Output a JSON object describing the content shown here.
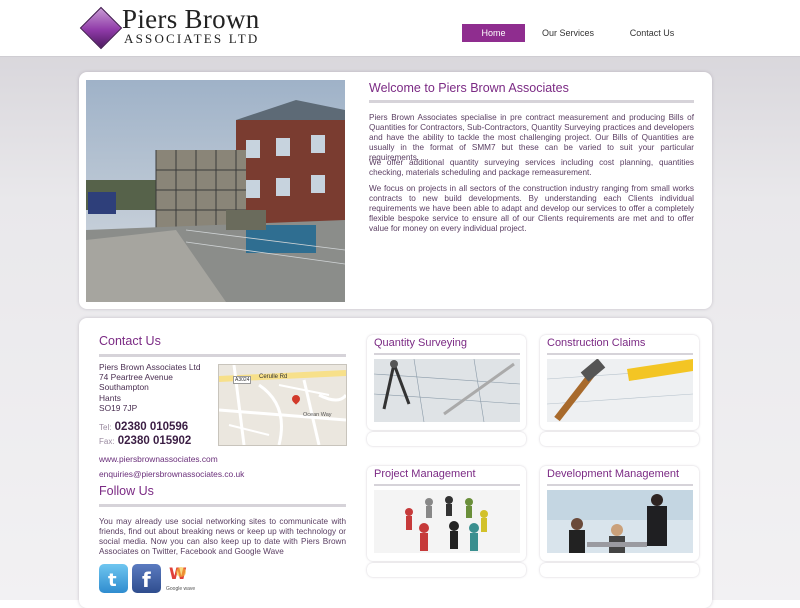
{
  "brand": {
    "name": "Piers Brown",
    "tagline": "ASSOCIATES LTD"
  },
  "nav": {
    "items": [
      {
        "label": "Home",
        "active": true
      },
      {
        "label": "Our Services",
        "active": false
      },
      {
        "label": "Contact Us",
        "active": false
      }
    ]
  },
  "welcome": {
    "title": "Welcome to Piers Brown Associates",
    "paragraphs": [
      "Piers Brown Associates specialise in pre contract measurement and producing Bills of Quantities for Contractors, Sub-Contractors, Quantity Surveying practices and developers and have the ability to tackle the most challenging project. Our Bills of Quantities are usually in the format of SMM7 but these can be varied to suit your particular requirements.",
      "We offer additional quantity surveying services including cost planning, quantities checking, materials scheduling and package remeasurement.",
      "We focus on projects in all sectors of the construction industry ranging from small works contracts to new build developments. By understanding each Clients individual requirements we have been able to adapt and develop our services to offer a completely flexible bespoke service to ensure all of our Clients requirements are met and to offer value for money on every individual project."
    ]
  },
  "contact": {
    "title": "Contact Us",
    "address": [
      "Piers Brown Associates Ltd",
      "74 Peartree Avenue",
      "Southampton",
      "Hants",
      "SO19 7JP"
    ],
    "tel_label": "Tel:",
    "tel": "02380 010596",
    "fax_label": "Fax:",
    "fax": "02380 015902",
    "website": "www.piersbrownassociates.com",
    "email": "enquiries@piersbrownassociates.co.uk",
    "map_road": "Cerulle Rd",
    "map_road2": "Ocean Way",
    "map_tag": "A3024"
  },
  "follow": {
    "title": "Follow Us",
    "text": "You may already use social networking sites to communicate with friends, find out about breaking news or keep up with technology or social media. Now you can also keep up to date with Piers Brown Associates on Twitter, Facebook and Google Wave",
    "google_wave_label": "Google wave"
  },
  "services": [
    {
      "title": "Quantity Surveying",
      "icon": "drawing-compass-image"
    },
    {
      "title": "Construction Claims",
      "icon": "hammer-tape-image"
    },
    {
      "title": "Project Management",
      "icon": "people-circle-image"
    },
    {
      "title": "Development Management",
      "icon": "office-team-image"
    }
  ],
  "colors": {
    "accent": "#8f2d8f",
    "heading": "#7b2a84",
    "text": "#5a3e62"
  }
}
